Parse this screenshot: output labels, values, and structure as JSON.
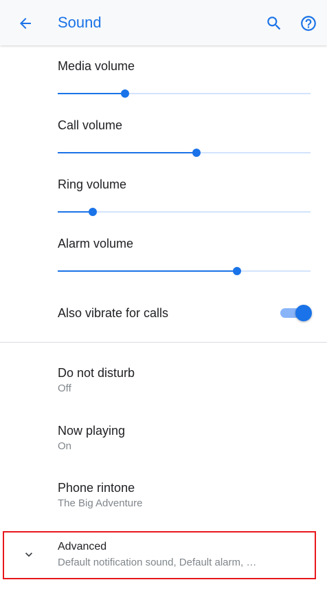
{
  "header": {
    "title": "Sound",
    "back_icon": "arrow-back-icon",
    "search_icon": "search-icon",
    "help_icon": "help-icon",
    "accent_color": "#1a73e8"
  },
  "volumes": [
    {
      "label": "Media volume",
      "level": 0.265
    },
    {
      "label": "Call volume",
      "level": 0.548
    },
    {
      "label": "Ring volume",
      "level": 0.139
    },
    {
      "label": "Alarm volume",
      "level": 0.71
    }
  ],
  "vibrate": {
    "label": "Also vibrate for calls",
    "on": true
  },
  "settings": [
    {
      "title": "Do not disturb",
      "subtitle": "Off"
    },
    {
      "title": "Now playing",
      "subtitle": "On"
    },
    {
      "title": "Phone rintone",
      "subtitle": "The Big Adventure"
    }
  ],
  "advanced": {
    "title": "Advanced",
    "subtitle": "Default notification sound, Default alarm, …",
    "icon": "chevron-down-icon",
    "highlight_color": "#e8161b"
  }
}
